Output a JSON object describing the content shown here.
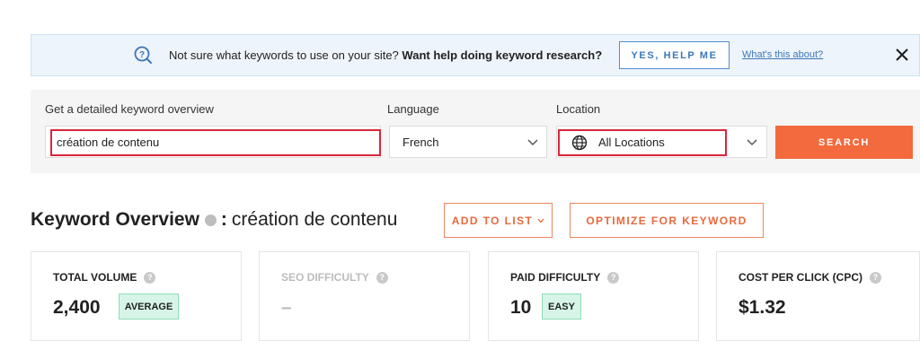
{
  "banner": {
    "message_plain": "Not sure what keywords to use on your site?",
    "message_bold": "Want help doing keyword research?",
    "help_button": "YES, HELP ME",
    "about_link": "What's this about?"
  },
  "search": {
    "keyword_label": "Get a detailed keyword overview",
    "keyword_value": "création de contenu",
    "language_label": "Language",
    "language_value": "French",
    "location_label": "Location",
    "location_value": "All Locations",
    "search_button": "SEARCH"
  },
  "overview": {
    "title": "Keyword Overview",
    "colon": ":",
    "keyword": "création de contenu",
    "add_to_list": "ADD TO LIST",
    "optimize": "OPTIMIZE FOR KEYWORD"
  },
  "metrics": [
    {
      "label": "TOTAL VOLUME",
      "value": "2,400",
      "badge": "AVERAGE"
    },
    {
      "label": "SEO DIFFICULTY",
      "value": "–",
      "badge": ""
    },
    {
      "label": "PAID DIFFICULTY",
      "value": "10",
      "badge": "EASY"
    },
    {
      "label": "COST PER CLICK (CPC)",
      "value": "$1.32",
      "badge": ""
    }
  ],
  "colors": {
    "accent_orange": "#f26a3d",
    "banner_bg": "#eef4fb",
    "link_blue": "#3b78b8",
    "highlight_red": "#d9253a",
    "badge_green": "#d6f5e8"
  }
}
